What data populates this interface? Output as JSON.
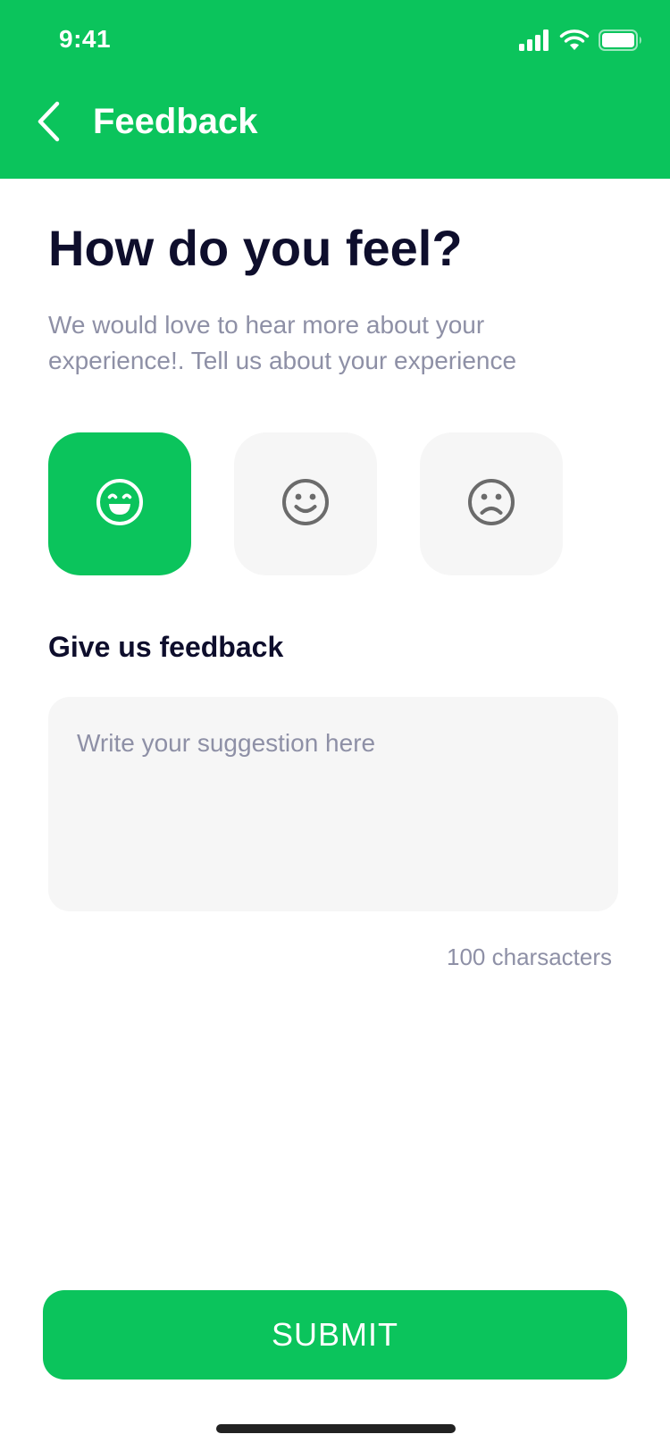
{
  "status_bar": {
    "time": "9:41"
  },
  "header": {
    "title": "Feedback",
    "back_icon": "chevron-left-icon",
    "background_color": "#0BC45C"
  },
  "content": {
    "title": "How do you feel?",
    "subtitle": "We would love to hear more about your experience!. Tell us about your experience",
    "moods": [
      {
        "icon": "happy-face-icon",
        "selected": true
      },
      {
        "icon": "smile-face-icon",
        "selected": false
      },
      {
        "icon": "sad-face-icon",
        "selected": false
      }
    ],
    "feedback_label": "Give us feedback",
    "feedback_input": {
      "value": "",
      "placeholder": "Write your suggestion here"
    },
    "char_limit_text": "100 charsacters"
  },
  "footer": {
    "submit_label": "SUBMIT"
  },
  "colors": {
    "accent": "#0BC45C",
    "title": "#0E0E2C",
    "muted": "#8E90A6",
    "surface": "#F6F6F6"
  }
}
